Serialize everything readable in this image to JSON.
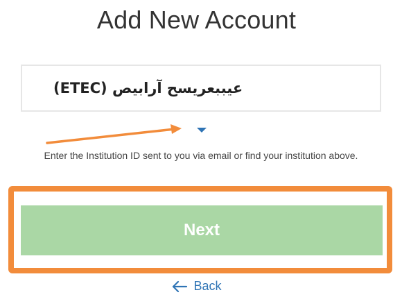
{
  "page": {
    "title": "Add New Account"
  },
  "institution_select": {
    "selected_value": "عيببعريسح آرابيص (ETEC)",
    "caret_icon": "chevron-down-icon"
  },
  "hint_text": "Enter the Institution ID sent to you via email or find your institution above.",
  "next_button": {
    "label": "Next",
    "color": "#aad7a5"
  },
  "back_link": {
    "label": "Back",
    "icon": "arrow-left-icon",
    "color": "#2f74b5"
  },
  "annotations": {
    "arrow_color": "#f28c3b",
    "frame_color": "#f28c3b"
  }
}
